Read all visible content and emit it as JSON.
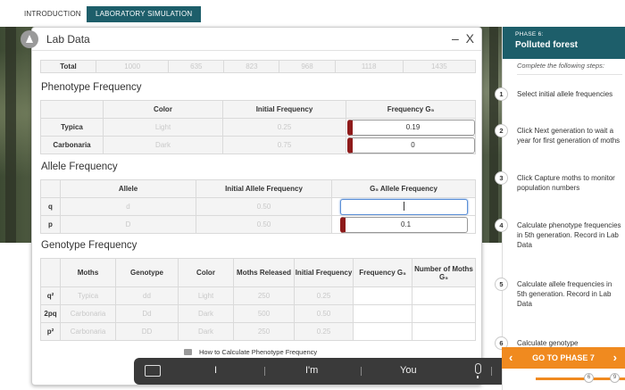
{
  "tabs": {
    "introduction": "INTRODUCTION",
    "lab_simulation": "LABORATORY SIMULATION"
  },
  "panel": {
    "title": "Lab Data",
    "controls": "– X"
  },
  "totals": {
    "label": "Total",
    "values": [
      "1000",
      "635",
      "823",
      "968",
      "1118",
      "1435"
    ]
  },
  "phenotype": {
    "title": "Phenotype Frequency",
    "headers": [
      "Color",
      "Initial Frequency",
      "Frequency G₅"
    ],
    "rows": [
      {
        "label": "Typica",
        "color": "Light",
        "initial": "0.25",
        "g5": "0.19"
      },
      {
        "label": "Carbonaria",
        "color": "Dark",
        "initial": "0.75",
        "g5": "0"
      }
    ]
  },
  "allele": {
    "title": "Allele Frequency",
    "headers": [
      "Allele",
      "Initial Allele Frequency",
      "G₅ Allele Frequency"
    ],
    "rows": [
      {
        "label": "q",
        "allele": "d",
        "initial": "0.50",
        "g5": ""
      },
      {
        "label": "p",
        "allele": "D",
        "initial": "0.50",
        "g5": "0.1"
      }
    ]
  },
  "genotype": {
    "title": "Genotype Frequency",
    "headers": [
      "Moths",
      "Genotype",
      "Color",
      "Moths Released",
      "Initial Frequency",
      "Frequency G₅",
      "Number of Moths G₅"
    ],
    "rows": [
      {
        "label": "q²",
        "moths": "Typica",
        "genotype": "dd",
        "color": "Light",
        "released": "250",
        "initial": "0.25"
      },
      {
        "label": "2pq",
        "moths": "Carbonaria",
        "genotype": "Dd",
        "color": "Dark",
        "released": "500",
        "initial": "0.50"
      },
      {
        "label": "p²",
        "moths": "Carbonaria",
        "genotype": "DD",
        "color": "Dark",
        "released": "250",
        "initial": "0.25"
      }
    ]
  },
  "help_link": "How to Calculate Phenotype Frequency",
  "keyboard": {
    "words": [
      "I",
      "I'm",
      "You"
    ]
  },
  "sidebar": {
    "phase_num": "PHASE 6:",
    "phase_name": "Polluted forest",
    "instructions": "Complete the following steps:",
    "steps": [
      {
        "num": "1",
        "text": "Select initial allele frequencies"
      },
      {
        "num": "2",
        "text": "Click Next generation to wait a year for first generation of moths"
      },
      {
        "num": "3",
        "text": "Click Capture moths to monitor population numbers"
      },
      {
        "num": "4",
        "text": "Calculate phenotype frequencies in 5th generation. Record in Lab Data"
      },
      {
        "num": "5",
        "text": "Calculate allele frequencies in 5th generation. Record in Lab Data"
      },
      {
        "num": "6",
        "text": "Calculate genotype"
      }
    ],
    "goto_label": "GO TO PHASE 7",
    "progress_dots": [
      "6",
      "9"
    ]
  },
  "colors": {
    "accent": "#1d5e6a",
    "orange": "#f08a1f",
    "error_mark": "#8e1b1b"
  }
}
